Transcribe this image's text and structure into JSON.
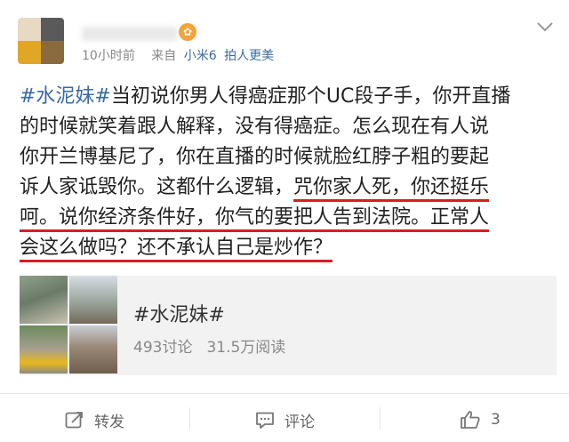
{
  "post": {
    "time": "10小时前",
    "source_prefix": "来自",
    "source_name": "小米6",
    "source_slogan": "拍人更美",
    "badge_icon": "medal-icon",
    "text_lines": [
      [
        "#水泥妹#",
        "当初说你男人得癌症那个UC段子手，你开直播"
      ],
      [
        "的时候就笑着跟人解释，没有得癌症。怎么现在有人说"
      ],
      [
        "你开兰博基尼了，你在直播的时候就脸红脖子粗的要起"
      ],
      [
        "诉人家诋毁你。这都什么逻辑，",
        "咒你家人死，你还挺乐"
      ],
      [
        "呵。说你经济条件好，你气的要把人告到法院。正常人"
      ],
      [
        "会这么做吗？还不承认自己是炒作？"
      ]
    ]
  },
  "topic_card": {
    "title": "#水泥妹#",
    "discussions": "493讨论",
    "reads": "31.5万阅读"
  },
  "actions": {
    "repost": "转发",
    "comment": "评论",
    "like_count": "3"
  },
  "colors": {
    "link": "#3a6aa1",
    "underline": "#d81e24",
    "card_bg": "#f2f2f2"
  }
}
